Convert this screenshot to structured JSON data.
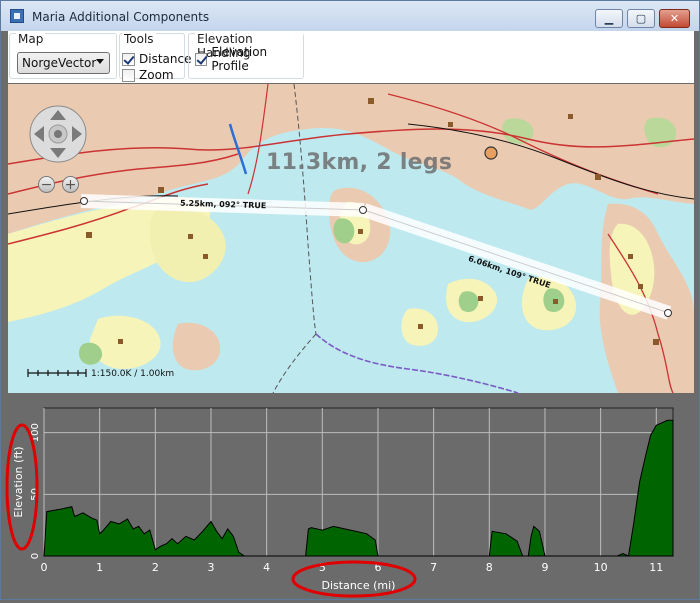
{
  "window": {
    "title": "Maria Additional Components",
    "minimize_glyph": "▁",
    "maximize_glyph": "▢",
    "close_glyph": "✕"
  },
  "toolbar": {
    "map_group": {
      "label": "Map",
      "selected": "NorgeVector"
    },
    "tools_group": {
      "label": "Tools",
      "items": [
        {
          "label": "Distance",
          "checked": true
        },
        {
          "label": "Zoom",
          "checked": false
        }
      ]
    },
    "elevation_group": {
      "label": "Elevation Handling",
      "items": [
        {
          "label": "Elevation Profile",
          "checked": true
        }
      ]
    }
  },
  "map": {
    "summary": "11.3km, 2 legs",
    "legs": [
      {
        "label": "5.25km, 092° TRUE"
      },
      {
        "label": "6.06km, 109° TRUE"
      }
    ],
    "scale_text": "1:150.0K / 1.00km",
    "zoom_out": "−",
    "zoom_in": "+",
    "colors": {
      "water": "#bde9ef",
      "land": "#eacbb2",
      "forest": "#f6f4b8",
      "route": "#ffffff"
    }
  },
  "chart_data": {
    "type": "area",
    "xlabel": "Distance (mi)",
    "ylabel": "Elevation (ft)",
    "xlim": [
      0,
      11.3
    ],
    "ylim": [
      0,
      120
    ],
    "xticks": [
      0,
      1,
      2,
      3,
      4,
      5,
      6,
      7,
      8,
      9,
      10,
      11
    ],
    "yticks": [
      0,
      50,
      100
    ],
    "grid": true,
    "fill_color": "#006400",
    "series": [
      {
        "x": [
          0,
          0.05,
          0.3,
          0.5,
          0.55,
          0.7,
          0.85,
          0.95,
          1.0,
          1.05,
          1.2,
          1.35,
          1.5,
          1.6,
          1.7,
          1.8,
          1.9,
          2.0,
          2.1,
          2.2,
          2.3,
          2.4,
          2.55,
          2.7,
          2.85,
          3.0,
          3.1,
          3.2,
          3.3,
          3.4,
          3.5,
          3.6,
          3.8,
          4.0,
          4.5,
          4.7,
          4.75,
          4.8,
          5.0,
          5.2,
          5.4,
          5.6,
          5.8,
          5.95,
          6.0,
          6.5,
          7.5,
          8.0,
          8.05,
          8.3,
          8.5,
          8.6,
          8.7,
          8.75,
          8.8,
          8.9,
          9.0,
          9.05,
          9.5,
          10.0,
          10.2,
          10.3,
          10.4,
          10.5,
          10.6,
          10.7,
          10.8,
          10.9,
          11.0,
          11.1,
          11.2,
          11.3
        ],
        "y": [
          0,
          36,
          38,
          40,
          32,
          35,
          31,
          29,
          18,
          20,
          28,
          26,
          30,
          22,
          24,
          18,
          21,
          5,
          8,
          10,
          14,
          10,
          16,
          13,
          20,
          28,
          20,
          14,
          22,
          16,
          3,
          0,
          0,
          0,
          0,
          0,
          22,
          23,
          21,
          24,
          22,
          20,
          18,
          13,
          0,
          0,
          0,
          0,
          20,
          18,
          12,
          0,
          0,
          16,
          24,
          20,
          0,
          0,
          0,
          0,
          0,
          0,
          2,
          0,
          28,
          60,
          80,
          98,
          106,
          108,
          110,
          110
        ]
      }
    ]
  }
}
